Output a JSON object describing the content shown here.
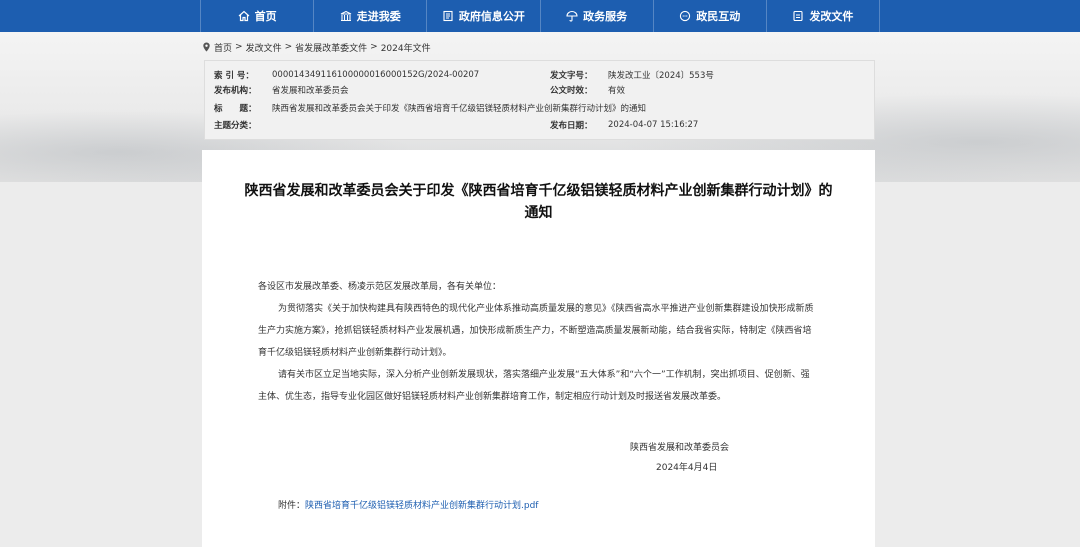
{
  "nav": {
    "items": [
      {
        "label": "首页",
        "icon": "home-icon"
      },
      {
        "label": "走进我委",
        "icon": "building-icon"
      },
      {
        "label": "政府信息公开",
        "icon": "document-icon"
      },
      {
        "label": "政务服务",
        "icon": "umbrella-icon"
      },
      {
        "label": "政民互动",
        "icon": "chat-icon"
      },
      {
        "label": "发改文件",
        "icon": "file-icon"
      }
    ]
  },
  "breadcrumb": {
    "items": [
      "首页",
      "发改文件",
      "省发展改革委文件",
      "2024年文件"
    ],
    "separator": ">"
  },
  "meta": {
    "index_label": "索 引 号：",
    "index_value": "000014349116100000016000152G/2024-00207",
    "publisher_label": "发布机构：",
    "publisher_value": "省发展和改革委员会",
    "title_label": "标　　题：",
    "title_value": "陕西省发展和改革委员会关于印发《陕西省培育千亿级铝镁轻质材料产业创新集群行动计划》的通知",
    "topic_label": "主题分类：",
    "topic_value": "",
    "doc_no_label": "发文字号：",
    "doc_no_value": "陕发改工业〔2024〕553号",
    "validity_label": "公文时效：",
    "validity_value": "有效",
    "date_label": "发布日期：",
    "date_value": "2024-04-07 15:16:27"
  },
  "document": {
    "title_line1": "陕西省发展和改革委员会关于印发《陕西省培育千亿级铝镁轻质材料产业创新集群行动计划》的",
    "title_line2": "通知",
    "salutation": "各设区市发展改革委、杨凌示范区发展改革局，各有关单位：",
    "paragraph1": "为贯彻落实《关于加快构建具有陕西特色的现代化产业体系推动高质量发展的意见》《陕西省高水平推进产业创新集群建设加快形成新质生产力实施方案》，抢抓铝镁轻质材料产业发展机遇，加快形成新质生产力，不断塑造高质量发展新动能，结合我省实际，特制定《陕西省培育千亿级铝镁轻质材料产业创新集群行动计划》。",
    "paragraph2": "请有关市区立足当地实际，深入分析产业创新发展现状，落实落细产业发展“五大体系”和“六个一”工作机制，突出抓项目、促创新、强主体、优生态，指导专业化园区做好铝镁轻质材料产业创新集群培育工作，制定相应行动计划及时报送省发展改革委。",
    "signature": "陕西省发展和改革委员会",
    "sign_date": "2024年4月4日",
    "attachment_label": "附件：",
    "attachment_link": "陕西省培育千亿级铝镁轻质材料产业创新集群行动计划.pdf"
  },
  "colors": {
    "nav_bg": "#1d5eb0",
    "link": "#1d5eb0"
  }
}
